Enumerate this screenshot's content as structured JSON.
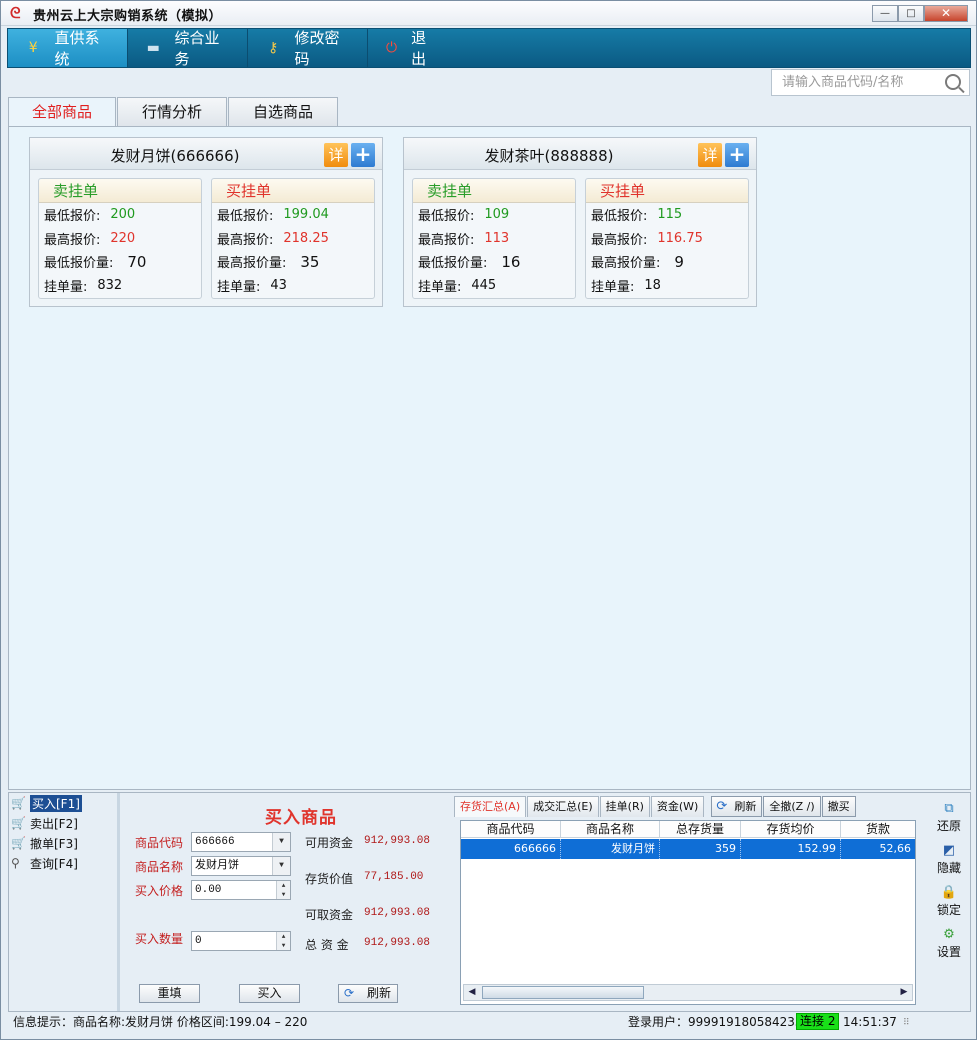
{
  "window": {
    "title": "贵州云上大宗购销系统（模拟）",
    "controls": [
      "—",
      "□",
      "✕"
    ]
  },
  "menu": [
    {
      "label": "直供系统",
      "icon": "yen-icon",
      "glyph": "¥",
      "active": true
    },
    {
      "label": "综合业务",
      "icon": "monitor-icon",
      "glyph": "▬",
      "active": false
    },
    {
      "label": "修改密码",
      "icon": "key-icon",
      "glyph": "⚷",
      "active": false
    },
    {
      "label": "退出",
      "icon": "power-icon",
      "glyph": "⏻",
      "active": false
    }
  ],
  "search": {
    "placeholder": "请输入商品代码/名称"
  },
  "tabs": [
    "全部商品",
    "行情分析",
    "自选商品"
  ],
  "cards": [
    {
      "title": "发财月饼(666666)",
      "detail_label": "详",
      "add_label": "+",
      "sell": {
        "title": "卖挂单",
        "rows": [
          {
            "label": "最低报价:",
            "value": "200"
          },
          {
            "label": "最高报价:",
            "value": "220"
          },
          {
            "label": "最低报价量:",
            "value": "70"
          },
          {
            "label": "挂单量:",
            "value": "832"
          }
        ]
      },
      "buy": {
        "title": "买挂单",
        "rows": [
          {
            "label": "最低报价:",
            "value": "199.04"
          },
          {
            "label": "最高报价:",
            "value": "218.25"
          },
          {
            "label": "最高报价量:",
            "value": "35"
          },
          {
            "label": "挂单量:",
            "value": "43"
          }
        ]
      }
    },
    {
      "title": "发财茶叶(888888)",
      "detail_label": "详",
      "add_label": "+",
      "sell": {
        "title": "卖挂单",
        "rows": [
          {
            "label": "最低报价:",
            "value": "109"
          },
          {
            "label": "最高报价:",
            "value": "113"
          },
          {
            "label": "最低报价量:",
            "value": "16"
          },
          {
            "label": "挂单量:",
            "value": "445"
          }
        ]
      },
      "buy": {
        "title": "买挂单",
        "rows": [
          {
            "label": "最低报价:",
            "value": "115"
          },
          {
            "label": "最高报价:",
            "value": "116.75"
          },
          {
            "label": "最高报价量:",
            "value": "9"
          },
          {
            "label": "挂单量:",
            "value": "18"
          }
        ]
      }
    }
  ],
  "left_nav": [
    {
      "label": "买入[F1]",
      "active": true
    },
    {
      "label": "卖出[F2]",
      "active": false
    },
    {
      "label": "撤单[F3]",
      "active": false
    },
    {
      "label": "查询[F4]",
      "active": false
    }
  ],
  "order_form": {
    "title": "买入商品",
    "code_label": "商品代码",
    "code_value": "666666",
    "name_label": "商品名称",
    "name_value": "发财月饼",
    "price_label": "买入价格",
    "price_value": "0.00",
    "qty_label": "买入数量",
    "qty_value": "0",
    "reset_label": "重填",
    "submit_label": "买入",
    "refresh_label": "刷新"
  },
  "funds": [
    {
      "label": "可用资金",
      "value": "912,993.08"
    },
    {
      "label": "存货价值",
      "value": "77,185.00"
    },
    {
      "label": "可取资金",
      "value": "912,993.08"
    },
    {
      "label": "总 资 金",
      "value": "912,993.08"
    }
  ],
  "holdings": {
    "tabs": [
      "存货汇总(A)",
      "成交汇总(E)",
      "挂单(R)",
      "资金(W)"
    ],
    "tools": [
      "刷新",
      "全撤(Z /)",
      "撤买"
    ],
    "columns": [
      "商品代码",
      "商品名称",
      "总存货量",
      "存货均价",
      "货款"
    ],
    "rows": [
      [
        "666666",
        "发财月饼",
        "359",
        "152.99",
        "52,66"
      ]
    ]
  },
  "side_buttons": [
    "还原",
    "隐藏",
    "锁定",
    "设置"
  ],
  "status": {
    "info": "信息提示：商品名称:发财月饼  价格区间:199.04 – 220",
    "user": "登录用户：999919180584235",
    "connection": "连接 2",
    "time": "14:51:37"
  },
  "colors": {
    "menu_bg": "#0b5a83",
    "menu_active": "#2a9fd2",
    "sell_green": "#1f9a1f",
    "buy_red": "#e0342c",
    "selection_blue": "#0f6ed6",
    "connected_green": "#19e019"
  }
}
